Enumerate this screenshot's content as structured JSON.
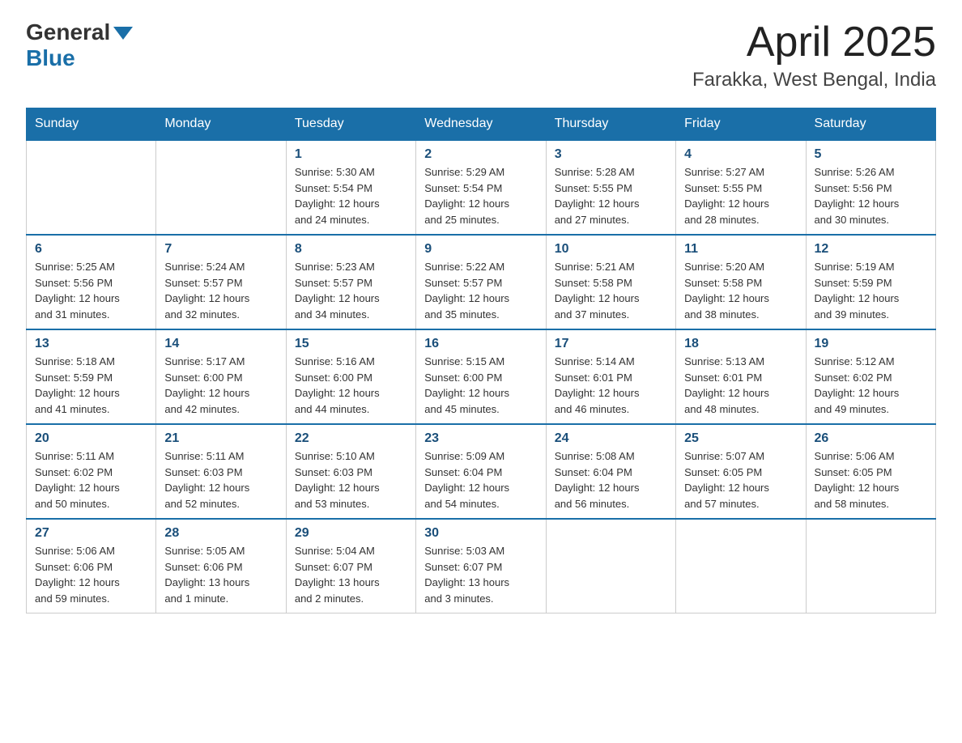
{
  "header": {
    "logo_general": "General",
    "logo_blue": "Blue",
    "title": "April 2025",
    "subtitle": "Farakka, West Bengal, India"
  },
  "weekdays": [
    "Sunday",
    "Monday",
    "Tuesday",
    "Wednesday",
    "Thursday",
    "Friday",
    "Saturday"
  ],
  "weeks": [
    [
      {
        "day": "",
        "info": ""
      },
      {
        "day": "",
        "info": ""
      },
      {
        "day": "1",
        "info": "Sunrise: 5:30 AM\nSunset: 5:54 PM\nDaylight: 12 hours\nand 24 minutes."
      },
      {
        "day": "2",
        "info": "Sunrise: 5:29 AM\nSunset: 5:54 PM\nDaylight: 12 hours\nand 25 minutes."
      },
      {
        "day": "3",
        "info": "Sunrise: 5:28 AM\nSunset: 5:55 PM\nDaylight: 12 hours\nand 27 minutes."
      },
      {
        "day": "4",
        "info": "Sunrise: 5:27 AM\nSunset: 5:55 PM\nDaylight: 12 hours\nand 28 minutes."
      },
      {
        "day": "5",
        "info": "Sunrise: 5:26 AM\nSunset: 5:56 PM\nDaylight: 12 hours\nand 30 minutes."
      }
    ],
    [
      {
        "day": "6",
        "info": "Sunrise: 5:25 AM\nSunset: 5:56 PM\nDaylight: 12 hours\nand 31 minutes."
      },
      {
        "day": "7",
        "info": "Sunrise: 5:24 AM\nSunset: 5:57 PM\nDaylight: 12 hours\nand 32 minutes."
      },
      {
        "day": "8",
        "info": "Sunrise: 5:23 AM\nSunset: 5:57 PM\nDaylight: 12 hours\nand 34 minutes."
      },
      {
        "day": "9",
        "info": "Sunrise: 5:22 AM\nSunset: 5:57 PM\nDaylight: 12 hours\nand 35 minutes."
      },
      {
        "day": "10",
        "info": "Sunrise: 5:21 AM\nSunset: 5:58 PM\nDaylight: 12 hours\nand 37 minutes."
      },
      {
        "day": "11",
        "info": "Sunrise: 5:20 AM\nSunset: 5:58 PM\nDaylight: 12 hours\nand 38 minutes."
      },
      {
        "day": "12",
        "info": "Sunrise: 5:19 AM\nSunset: 5:59 PM\nDaylight: 12 hours\nand 39 minutes."
      }
    ],
    [
      {
        "day": "13",
        "info": "Sunrise: 5:18 AM\nSunset: 5:59 PM\nDaylight: 12 hours\nand 41 minutes."
      },
      {
        "day": "14",
        "info": "Sunrise: 5:17 AM\nSunset: 6:00 PM\nDaylight: 12 hours\nand 42 minutes."
      },
      {
        "day": "15",
        "info": "Sunrise: 5:16 AM\nSunset: 6:00 PM\nDaylight: 12 hours\nand 44 minutes."
      },
      {
        "day": "16",
        "info": "Sunrise: 5:15 AM\nSunset: 6:00 PM\nDaylight: 12 hours\nand 45 minutes."
      },
      {
        "day": "17",
        "info": "Sunrise: 5:14 AM\nSunset: 6:01 PM\nDaylight: 12 hours\nand 46 minutes."
      },
      {
        "day": "18",
        "info": "Sunrise: 5:13 AM\nSunset: 6:01 PM\nDaylight: 12 hours\nand 48 minutes."
      },
      {
        "day": "19",
        "info": "Sunrise: 5:12 AM\nSunset: 6:02 PM\nDaylight: 12 hours\nand 49 minutes."
      }
    ],
    [
      {
        "day": "20",
        "info": "Sunrise: 5:11 AM\nSunset: 6:02 PM\nDaylight: 12 hours\nand 50 minutes."
      },
      {
        "day": "21",
        "info": "Sunrise: 5:11 AM\nSunset: 6:03 PM\nDaylight: 12 hours\nand 52 minutes."
      },
      {
        "day": "22",
        "info": "Sunrise: 5:10 AM\nSunset: 6:03 PM\nDaylight: 12 hours\nand 53 minutes."
      },
      {
        "day": "23",
        "info": "Sunrise: 5:09 AM\nSunset: 6:04 PM\nDaylight: 12 hours\nand 54 minutes."
      },
      {
        "day": "24",
        "info": "Sunrise: 5:08 AM\nSunset: 6:04 PM\nDaylight: 12 hours\nand 56 minutes."
      },
      {
        "day": "25",
        "info": "Sunrise: 5:07 AM\nSunset: 6:05 PM\nDaylight: 12 hours\nand 57 minutes."
      },
      {
        "day": "26",
        "info": "Sunrise: 5:06 AM\nSunset: 6:05 PM\nDaylight: 12 hours\nand 58 minutes."
      }
    ],
    [
      {
        "day": "27",
        "info": "Sunrise: 5:06 AM\nSunset: 6:06 PM\nDaylight: 12 hours\nand 59 minutes."
      },
      {
        "day": "28",
        "info": "Sunrise: 5:05 AM\nSunset: 6:06 PM\nDaylight: 13 hours\nand 1 minute."
      },
      {
        "day": "29",
        "info": "Sunrise: 5:04 AM\nSunset: 6:07 PM\nDaylight: 13 hours\nand 2 minutes."
      },
      {
        "day": "30",
        "info": "Sunrise: 5:03 AM\nSunset: 6:07 PM\nDaylight: 13 hours\nand 3 minutes."
      },
      {
        "day": "",
        "info": ""
      },
      {
        "day": "",
        "info": ""
      },
      {
        "day": "",
        "info": ""
      }
    ]
  ]
}
